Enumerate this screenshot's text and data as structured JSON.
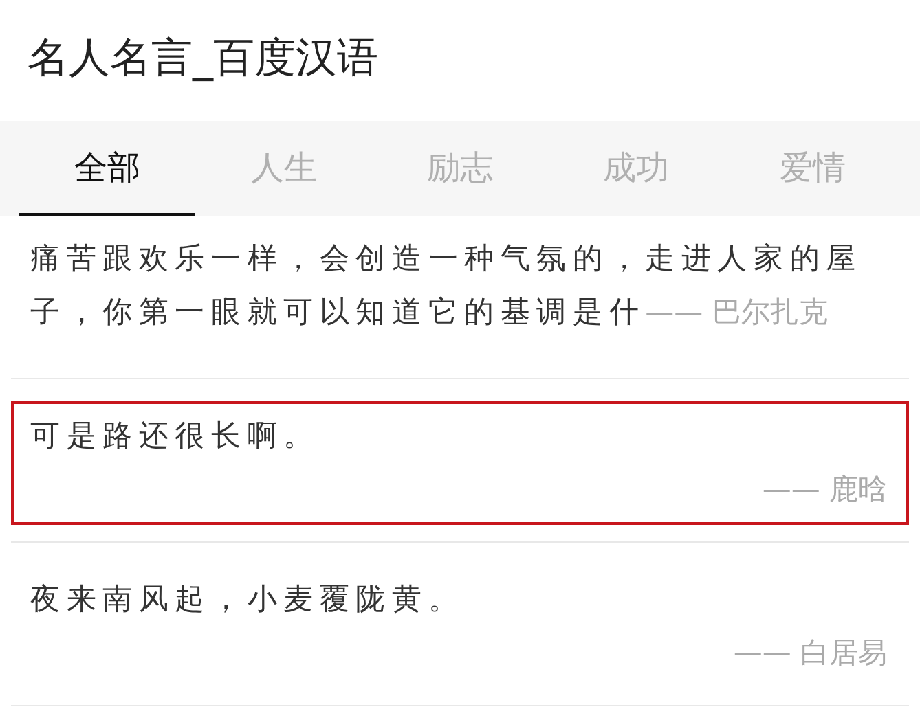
{
  "title": "名人名言_百度汉语",
  "tabs": [
    {
      "label": "全部",
      "selected": true
    },
    {
      "label": "人生",
      "selected": false
    },
    {
      "label": "励志",
      "selected": false
    },
    {
      "label": "成功",
      "selected": false
    },
    {
      "label": "爱情",
      "selected": false
    }
  ],
  "quotes": [
    {
      "text": "痛苦跟欢乐一样，会创造一种气氛的，走进人家的屋子，你第一眼就可以知道它的基调是什",
      "author": "—— 巴尔扎克",
      "kind": "inline",
      "highlighted": false
    },
    {
      "text": "可是路还很长啊。",
      "author": "—— 鹿晗",
      "kind": "block",
      "highlighted": true
    },
    {
      "text": "夜来南风起，小麦覆陇黄。",
      "author": "—— 白居易",
      "kind": "block",
      "highlighted": false
    }
  ]
}
